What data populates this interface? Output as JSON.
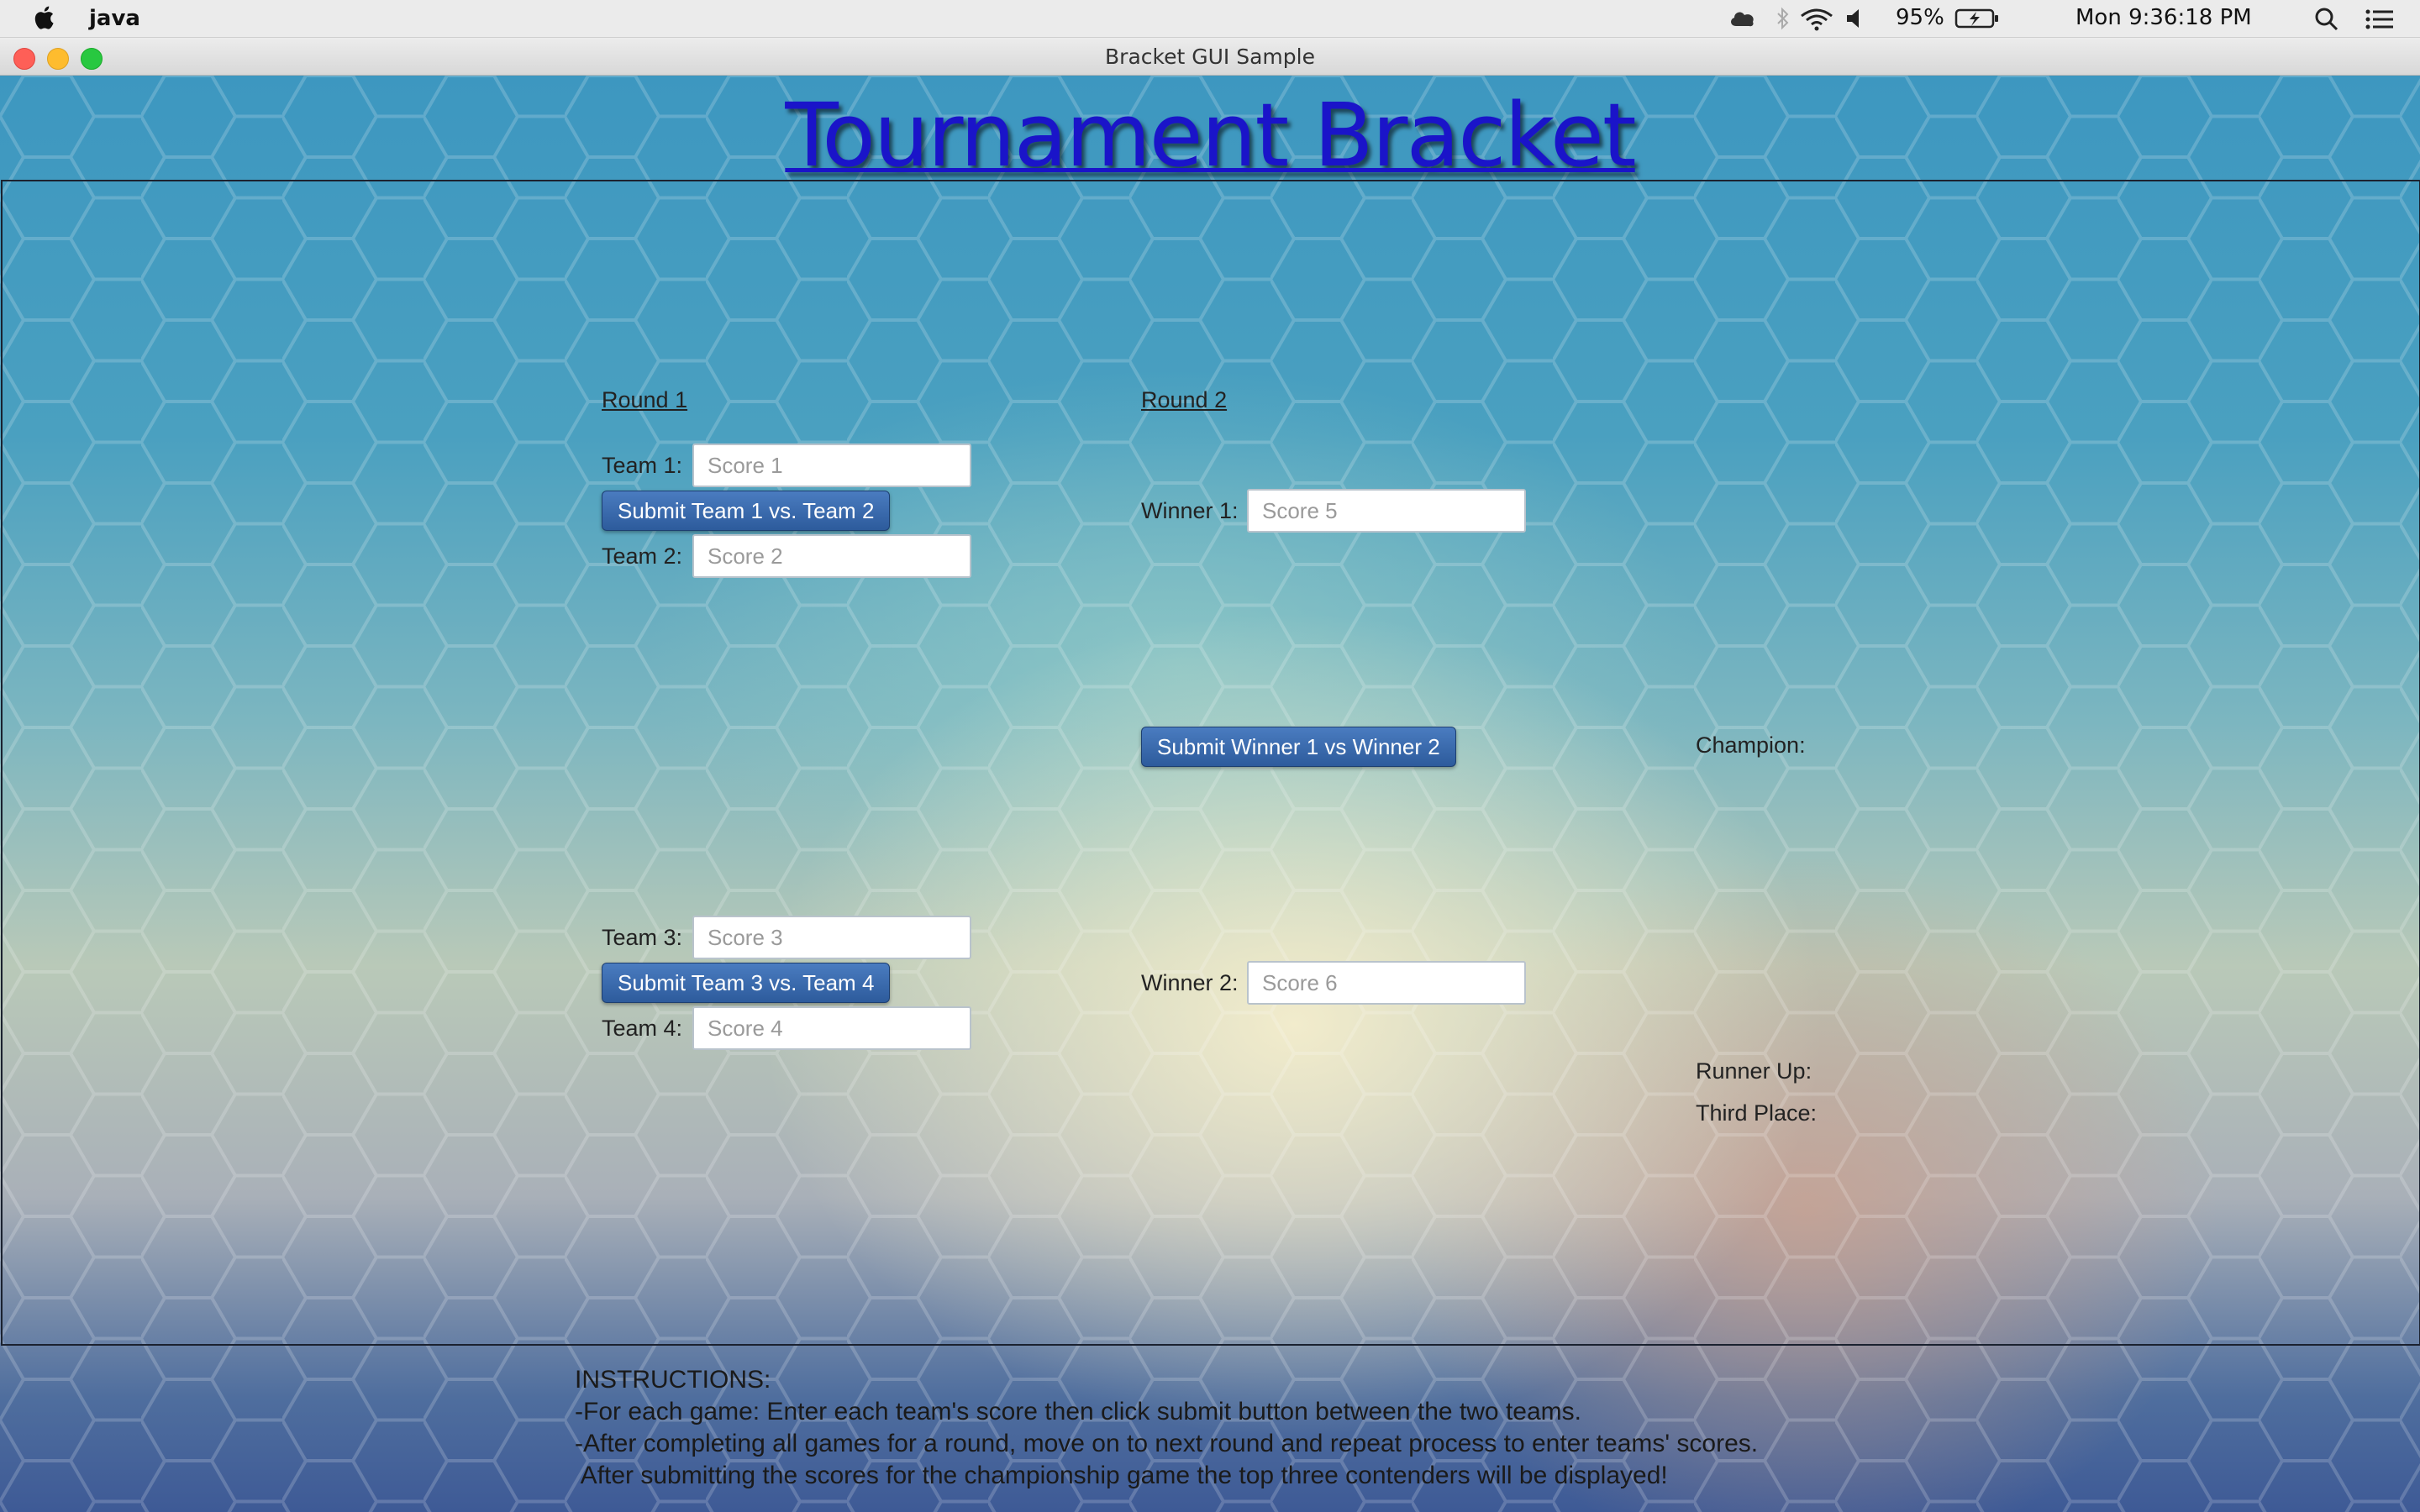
{
  "menubar": {
    "app_name": "java",
    "battery": "95%",
    "clock": "Mon 9:36:18 PM",
    "icons": [
      "apple-icon",
      "creative-cloud-icon",
      "bluetooth-icon",
      "wifi-icon",
      "volume-icon",
      "battery-icon",
      "spotlight-search-icon",
      "notification-center-icon"
    ]
  },
  "window": {
    "title": "Bracket GUI Sample",
    "traffic_lights": {
      "close": "#ff5f57",
      "minimize": "#febc2e",
      "zoom": "#28c840"
    }
  },
  "app": {
    "title": "Tournament Bracket",
    "title_color": "#1a14c9",
    "round1": {
      "label": "Round 1",
      "team1_label": "Team 1:",
      "team1_placeholder": "Score 1",
      "submit1_label": "Submit Team 1 vs. Team 2",
      "team2_label": "Team 2:",
      "team2_placeholder": "Score 2",
      "team3_label": "Team 3:",
      "team3_placeholder": "Score 3",
      "submit2_label": "Submit Team 3 vs. Team 4",
      "team4_label": "Team 4:",
      "team4_placeholder": "Score 4"
    },
    "round2": {
      "label": "Round 2",
      "winner1_label": "Winner 1:",
      "winner1_placeholder": "Score 5",
      "submit_label": "Submit Winner 1 vs Winner 2",
      "winner2_label": "Winner 2:",
      "winner2_placeholder": "Score 6"
    },
    "results": {
      "champion_label": "Champion:",
      "runner_up_label": "Runner Up:",
      "third_place_label": "Third Place:"
    },
    "instructions": {
      "heading": "INSTRUCTIONS:",
      "line1": "-For each game: Enter each team's score then click submit button between the two teams.",
      "line2": "-After completing all games for a round, move on to next round and repeat process to enter teams' scores.",
      "line3": " After submitting the scores for the championship game the top three contenders will be displayed!"
    },
    "button_color": "#2d5b9c"
  }
}
